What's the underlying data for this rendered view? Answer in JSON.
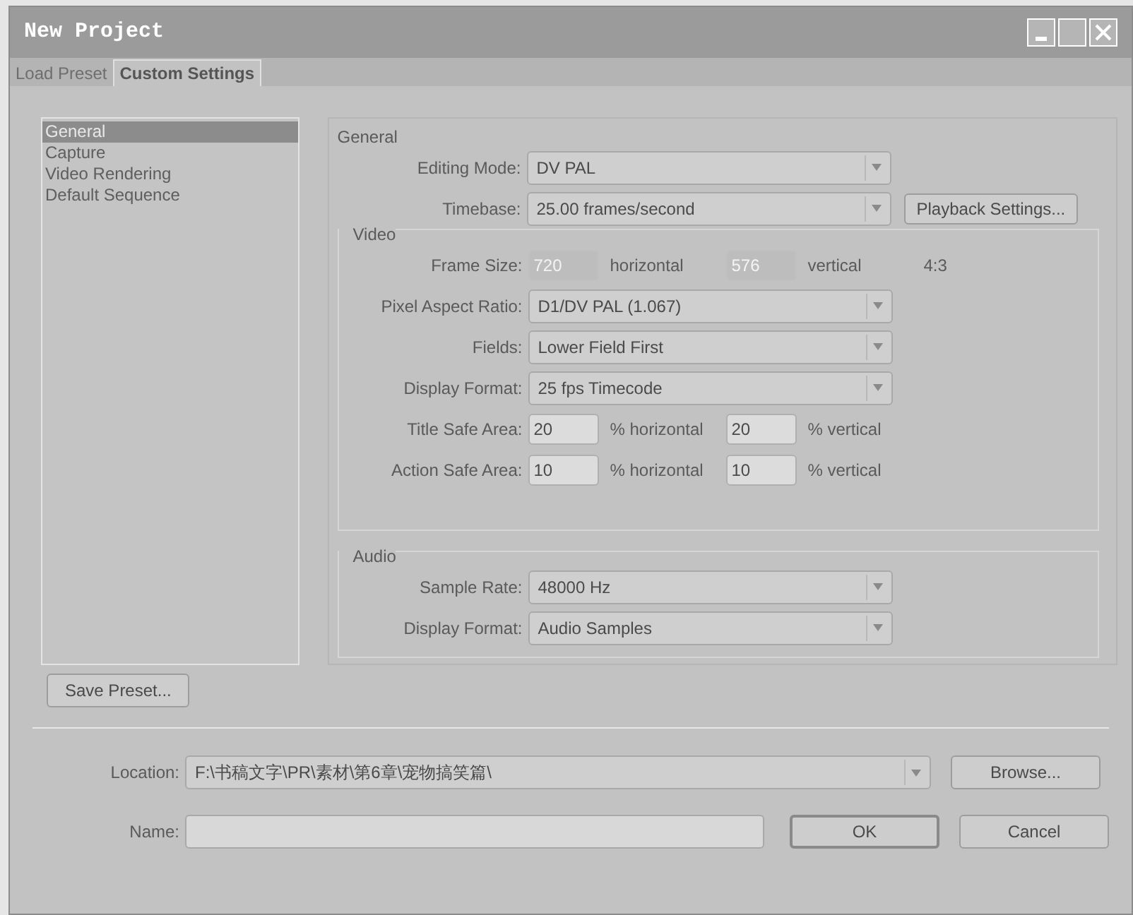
{
  "window": {
    "title": "New Project"
  },
  "tabs": [
    {
      "label": "Load Preset",
      "selected": false
    },
    {
      "label": "Custom Settings",
      "selected": true
    }
  ],
  "sidebar": {
    "items": [
      {
        "label": "General",
        "selected": true
      },
      {
        "label": "Capture",
        "selected": false
      },
      {
        "label": "Video Rendering",
        "selected": false
      },
      {
        "label": "Default Sequence",
        "selected": false
      }
    ]
  },
  "general": {
    "title": "General",
    "rows": [
      {
        "kind": "dropdown",
        "label": "Editing Mode:",
        "value": "DV PAL"
      },
      {
        "kind": "dropdown",
        "label": "Timebase:",
        "value": "25.00 frames/second",
        "button": "Playback Settings..."
      }
    ]
  },
  "video": {
    "title": "Video",
    "rows": [
      {
        "kind": "pair",
        "label": "Frame Size:",
        "fields": [
          {
            "value": "720",
            "unit": "horizontal",
            "disabled": true
          },
          {
            "value": "576",
            "unit": "vertical",
            "disabled": true
          }
        ],
        "note": "4:3"
      },
      {
        "kind": "dropdown",
        "label": "Pixel Aspect Ratio:",
        "value": "D1/DV PAL (1.067)"
      },
      {
        "kind": "dropdown",
        "label": "Fields:",
        "value": "Lower Field First"
      },
      {
        "kind": "dropdown",
        "label": "Display Format:",
        "value": "25 fps Timecode"
      },
      {
        "kind": "pair",
        "label": "Title Safe Area:",
        "fields": [
          {
            "value": "20",
            "unit": "% horizontal",
            "disabled": false
          },
          {
            "value": "20",
            "unit": "% vertical",
            "disabled": false
          }
        ]
      },
      {
        "kind": "pair",
        "label": "Action Safe Area:",
        "fields": [
          {
            "value": "10",
            "unit": "% horizontal",
            "disabled": false
          },
          {
            "value": "10",
            "unit": "% vertical",
            "disabled": false
          }
        ]
      }
    ]
  },
  "audio": {
    "title": "Audio",
    "rows": [
      {
        "kind": "dropdown",
        "label": "Sample Rate:",
        "value": "48000 Hz"
      },
      {
        "kind": "dropdown",
        "label": "Display Format:",
        "value": "Audio Samples"
      }
    ]
  },
  "save_button": "Save Preset...",
  "location": {
    "label": "Location:",
    "value": "F:\\书稿文字\\PR\\素材\\第6章\\宠物搞笑篇\\"
  },
  "browse_button": "Browse...",
  "name": {
    "label": "Name:"
  },
  "ok_button": "OK",
  "cancel_button": "Cancel"
}
